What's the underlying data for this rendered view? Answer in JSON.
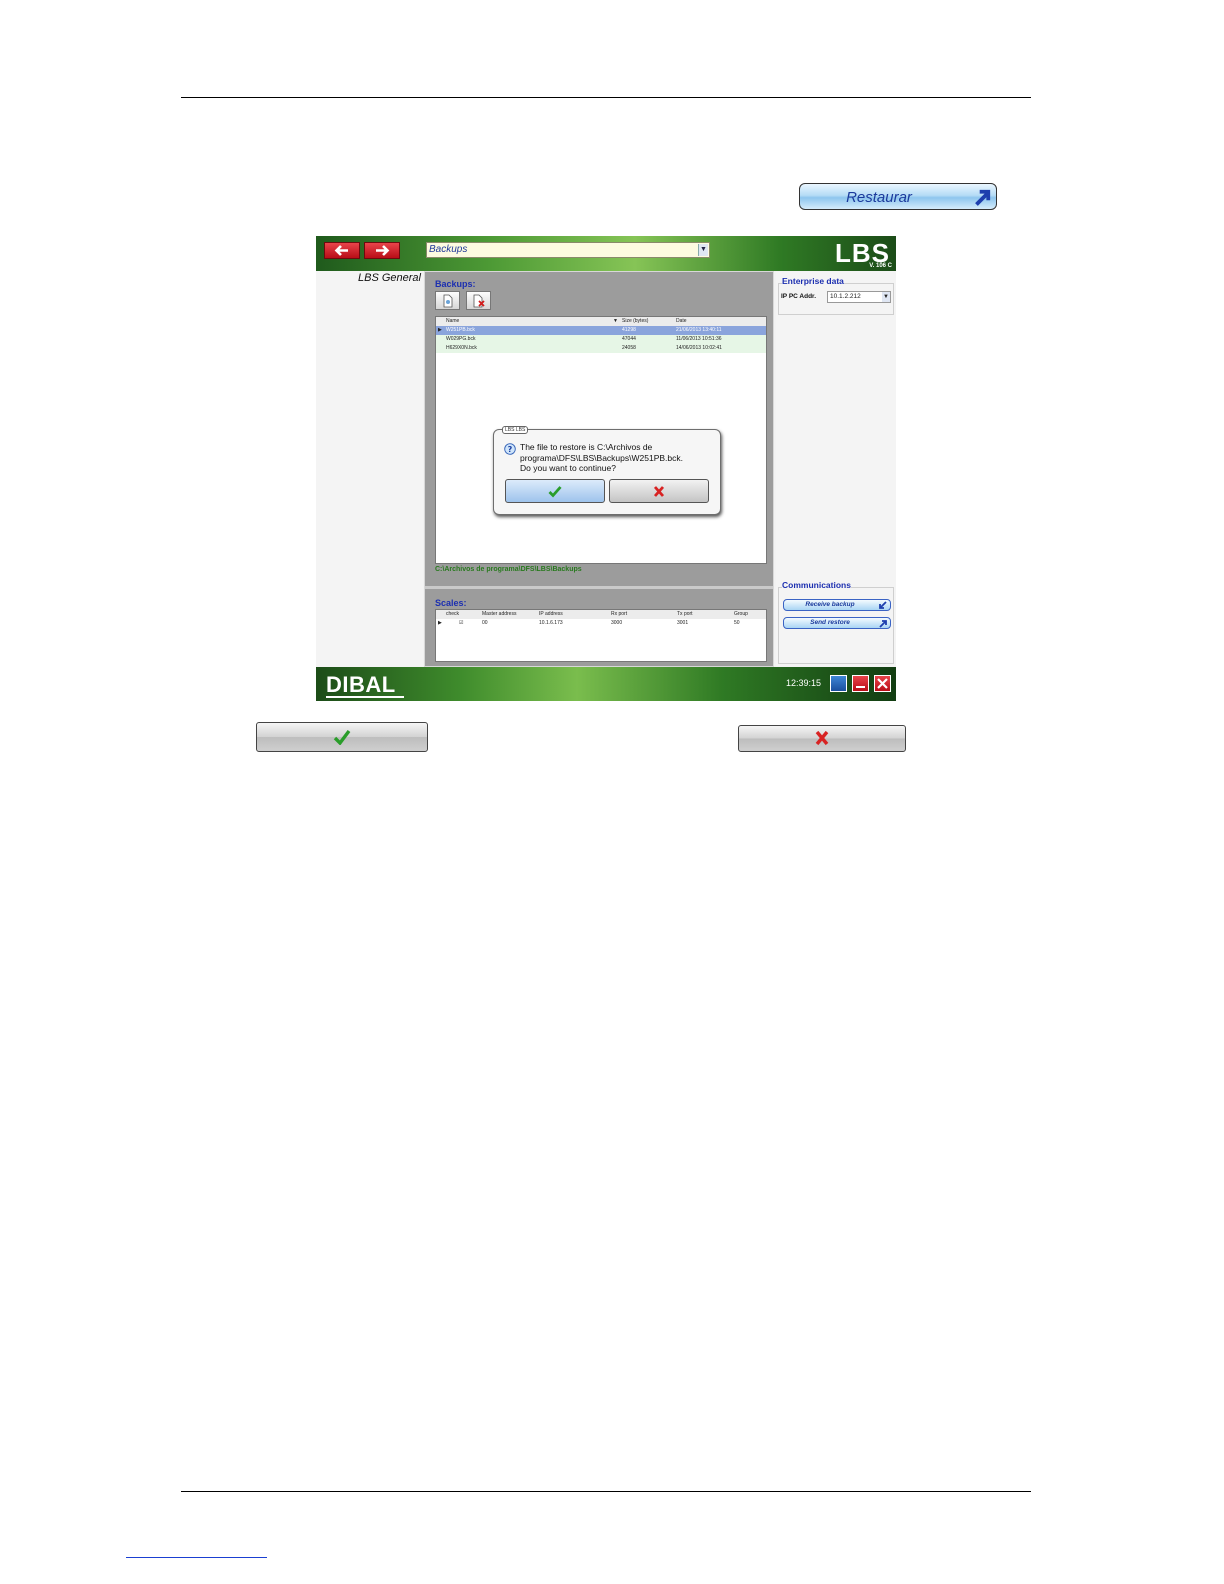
{
  "restaurar_button": {
    "label": "Restaurar"
  },
  "app": {
    "combo_value": "Backups",
    "logo": "LBS",
    "version": "V. 106 C",
    "left_title": "LBS General",
    "backups": {
      "title": "Backups:",
      "columns": [
        "Name",
        "Size (bytes)",
        "Date"
      ],
      "rows": [
        {
          "name": "W251PB.bck",
          "size": "41298",
          "date": "21/06/2013 13:40:11"
        },
        {
          "name": "W029PG.bck",
          "size": "47044",
          "date": "11/06/2013 10:51:36"
        },
        {
          "name": "H629X0N.bck",
          "size": "24058",
          "date": "14/06/2013 10:02:41"
        }
      ],
      "path": "C:\\Archivos de programa\\DFS\\LBS\\Backups"
    },
    "dialog": {
      "tag": "LBS LBS",
      "message_line1": "The file to restore is C:\\Archivos de",
      "message_line2": "programa\\DFS\\LBS\\Backups\\W251PB.bck.",
      "message_line3": "Do you want to continue?"
    },
    "scales": {
      "title": "Scales:",
      "columns": [
        "check",
        "Master address",
        "IP address",
        "Rx port",
        "Tx port",
        "Group"
      ],
      "rows": [
        {
          "master": "00",
          "ip": "10.1.6.173",
          "rx": "3000",
          "tx": "3001",
          "group": "50"
        }
      ]
    },
    "enterprise": {
      "legend": "Enterprise data",
      "ip_label": "IP PC Addr.",
      "ip_value": "10.1.2.212"
    },
    "communications": {
      "legend": "Communications",
      "receive_label": "Receive backup",
      "send_label": "Send restore"
    },
    "brand": "DIBAL",
    "clock": "12:39:15"
  },
  "colors": {
    "accent_blue": "#1c2fb0",
    "path_green": "#287a1e",
    "selected_row": "#8aa4dc"
  }
}
